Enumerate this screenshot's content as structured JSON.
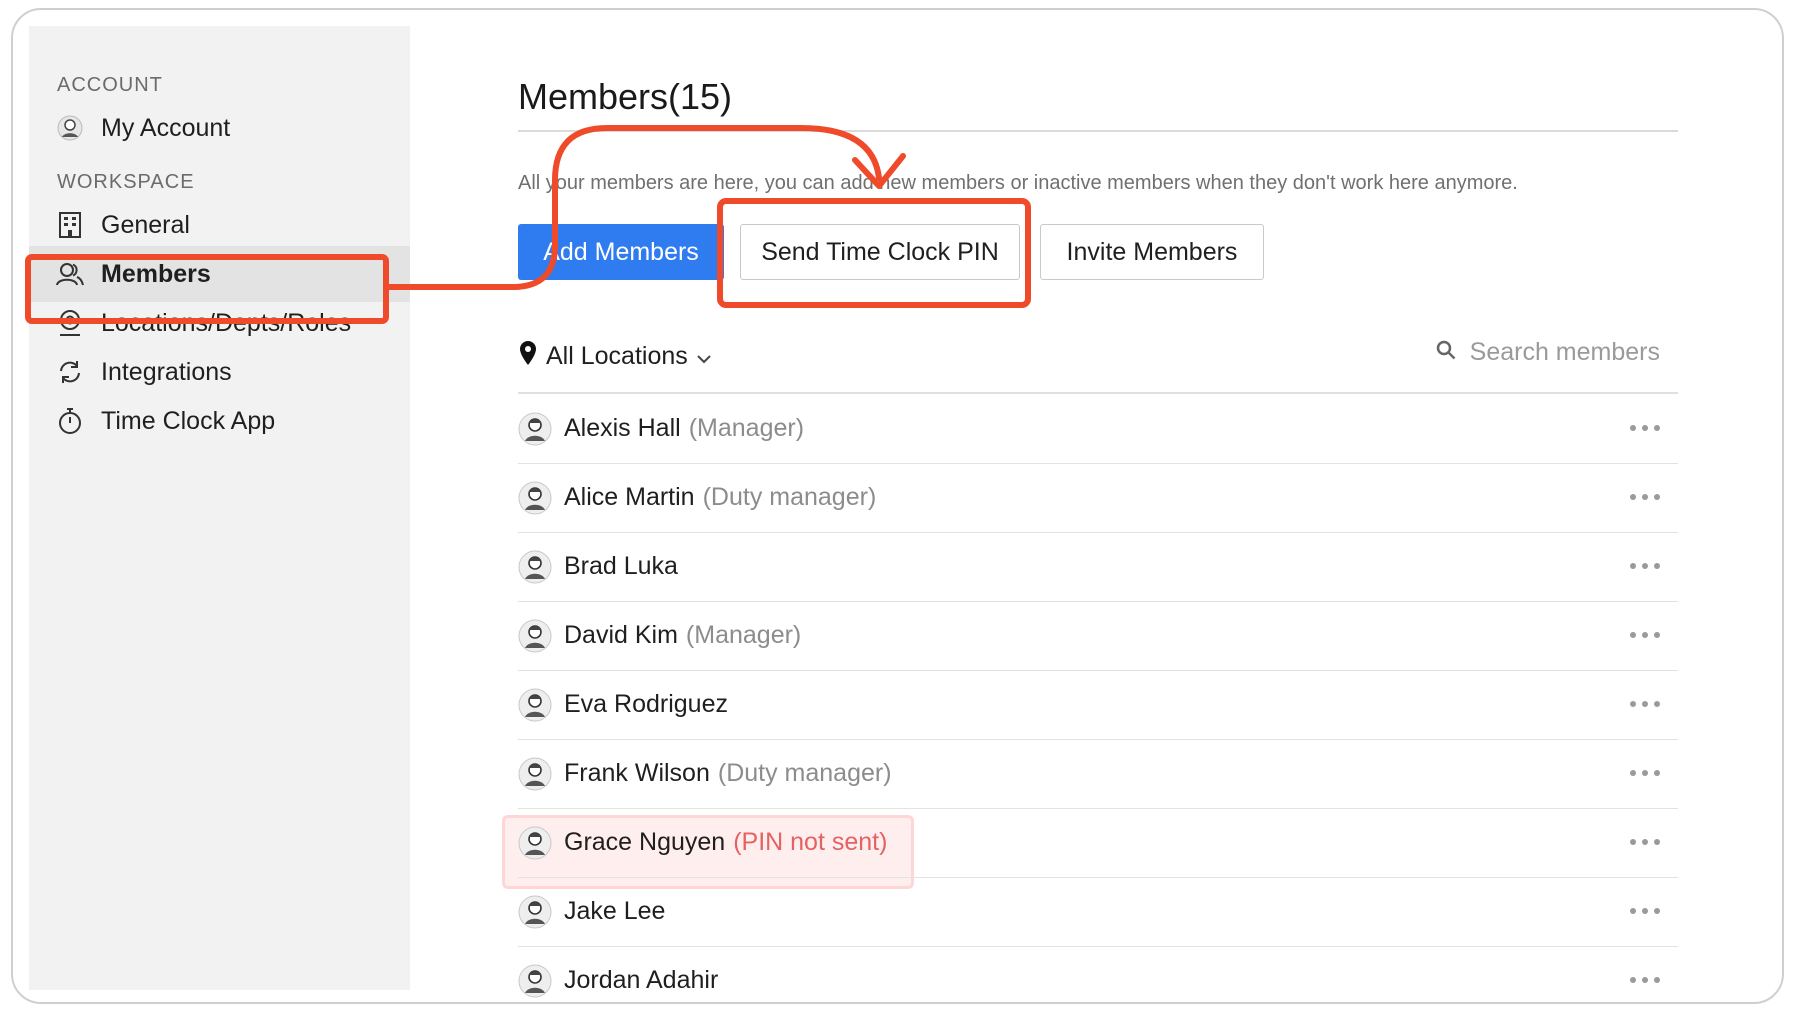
{
  "sidebar": {
    "account_heading": "ACCOUNT",
    "workspace_heading": "WORKSPACE",
    "items": [
      {
        "label": "My Account",
        "icon": "user-avatar-icon"
      },
      {
        "label": "General",
        "icon": "building-icon"
      },
      {
        "label": "Members",
        "icon": "users-icon",
        "active": true
      },
      {
        "label": "Locations/Depts/Roles",
        "icon": "location-pin-icon"
      },
      {
        "label": "Integrations",
        "icon": "sync-icon"
      },
      {
        "label": "Time Clock App",
        "icon": "stopwatch-icon"
      }
    ]
  },
  "main": {
    "title": "Members(15)",
    "subtitle": "All your members are here, you can add new members or inactive members when they don't work here anymore.",
    "buttons": {
      "add": "Add Members",
      "send_pin": "Send Time Clock PIN",
      "invite": "Invite Members"
    },
    "location_filter": "All Locations",
    "search_placeholder": "Search members",
    "members": [
      {
        "name": "Alexis Hall",
        "role": "(Manager)"
      },
      {
        "name": "Alice Martin",
        "role": "(Duty manager)"
      },
      {
        "name": "Brad Luka",
        "role": ""
      },
      {
        "name": "David Kim",
        "role": "(Manager)"
      },
      {
        "name": "Eva Rodriguez",
        "role": ""
      },
      {
        "name": "Frank Wilson",
        "role": "(Duty manager)"
      },
      {
        "name": "Grace Nguyen",
        "role": "(PIN not sent)",
        "warning": true
      },
      {
        "name": "Jake Lee",
        "role": ""
      },
      {
        "name": "Jordan Adahir",
        "role": ""
      }
    ]
  },
  "colors": {
    "primary_button": "#2f7bf0",
    "annotation_red": "#ef4a2a",
    "warning_text": "#e46262"
  }
}
